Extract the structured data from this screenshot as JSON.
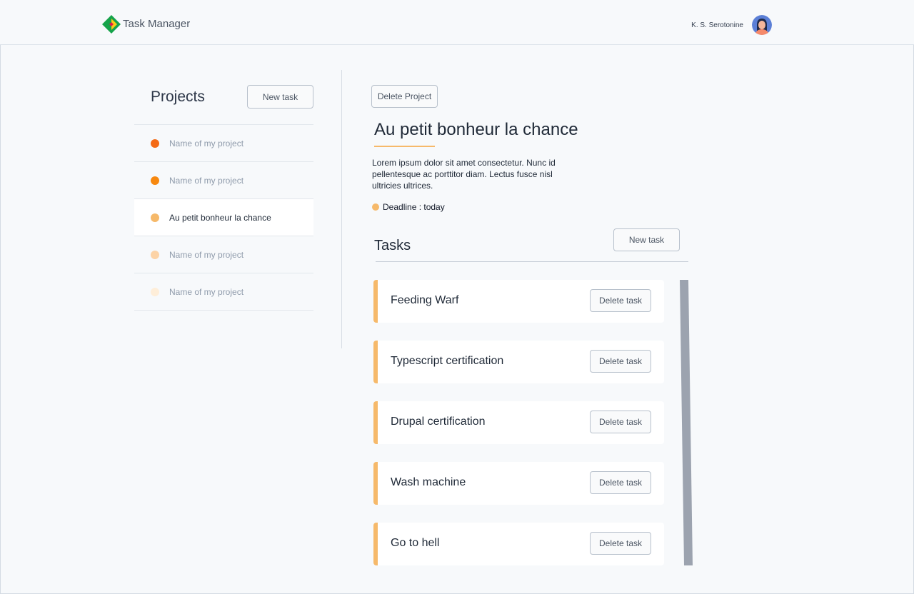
{
  "header": {
    "app_title": "Task Manager",
    "user_name": "K. S. Serotonine",
    "logo_icon": "diamond-logo-icon",
    "avatar_icon": "user-avatar-icon"
  },
  "sidebar": {
    "title": "Projects",
    "new_task_label": "New task",
    "projects": [
      {
        "label": "Name of my project",
        "color": "#f46a15",
        "active": false
      },
      {
        "label": "Name of my project",
        "color": "#f7880f",
        "active": false
      },
      {
        "label": "Au petit bonheur la chance",
        "color": "#f6b96a",
        "active": true
      },
      {
        "label": "Name of my project",
        "color": "#fcd3a6",
        "active": false
      },
      {
        "label": "Name of my project",
        "color": "#feeed9",
        "active": false
      }
    ]
  },
  "main": {
    "delete_project_label": "Delete Project",
    "project_title": "Au petit bonheur la chance",
    "description": "Lorem ipsum dolor sit amet consectetur. Nunc id pellentesque ac porttitor diam. Lectus fusce nisl ultricies ultrices.",
    "deadline": "Deadline : today",
    "tasks_title": "Tasks",
    "new_task_label": "New task",
    "delete_task_label": "Delete task",
    "tasks": [
      {
        "label": "Feeding Warf"
      },
      {
        "label": "Typescript certification"
      },
      {
        "label": "Drupal certification"
      },
      {
        "label": "Wash machine"
      },
      {
        "label": "Go to hell"
      }
    ]
  },
  "colors": {
    "accent": "#f6b96a",
    "scrollbar": "#9ca3af"
  }
}
